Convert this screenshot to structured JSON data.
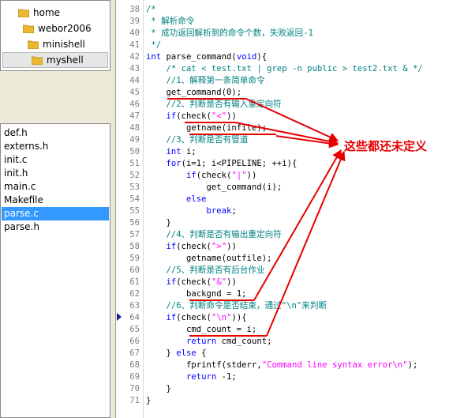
{
  "folder_tree": {
    "items": [
      {
        "label": "home"
      },
      {
        "label": "webor2006"
      },
      {
        "label": "minishell"
      },
      {
        "label": "myshell",
        "selected": true
      }
    ]
  },
  "file_list": {
    "items": [
      {
        "label": "def.h"
      },
      {
        "label": "externs.h"
      },
      {
        "label": "init.c"
      },
      {
        "label": "init.h"
      },
      {
        "label": "main.c"
      },
      {
        "label": "Makefile"
      },
      {
        "label": "parse.c",
        "selected": true
      },
      {
        "label": "parse.h"
      }
    ]
  },
  "editor": {
    "lines": [
      {
        "n": "38",
        "segs": [
          {
            "c": "comment",
            "t": "/*"
          }
        ]
      },
      {
        "n": "39",
        "segs": [
          {
            "c": "comment",
            "t": " * 解析命令"
          }
        ]
      },
      {
        "n": "40",
        "segs": [
          {
            "c": "comment",
            "t": " * 成功返回解析到的命令个数，失败返回-1"
          }
        ]
      },
      {
        "n": "41",
        "segs": [
          {
            "c": "comment",
            "t": " */"
          }
        ]
      },
      {
        "n": "42",
        "segs": [
          {
            "c": "keyword",
            "t": "int"
          },
          {
            "c": "plain",
            "t": " parse_command("
          },
          {
            "c": "keyword",
            "t": "void"
          },
          {
            "c": "plain",
            "t": "){"
          }
        ]
      },
      {
        "n": "43",
        "segs": [
          {
            "c": "comment",
            "t": "    /* cat < test.txt | grep -n public > test2.txt & */"
          }
        ]
      },
      {
        "n": "44",
        "segs": [
          {
            "c": "comment",
            "t": "    //1、解释第一条简单命令"
          }
        ]
      },
      {
        "n": "45",
        "segs": [
          {
            "c": "plain",
            "t": "    get_command(0);"
          }
        ]
      },
      {
        "n": "46",
        "segs": [
          {
            "c": "comment",
            "t": "    //2、判断是否有输入重定向符"
          }
        ]
      },
      {
        "n": "47",
        "segs": [
          {
            "c": "keyword",
            "t": "    if"
          },
          {
            "c": "plain",
            "t": "(check("
          },
          {
            "c": "string",
            "t": "\"<\""
          },
          {
            "c": "plain",
            "t": "))"
          }
        ]
      },
      {
        "n": "48",
        "segs": [
          {
            "c": "plain",
            "t": "        getname(infile);"
          }
        ]
      },
      {
        "n": "49",
        "segs": [
          {
            "c": "comment",
            "t": "    //3、判断是否有管道"
          }
        ]
      },
      {
        "n": "50",
        "segs": [
          {
            "c": "keyword",
            "t": "    int"
          },
          {
            "c": "plain",
            "t": " i;"
          }
        ]
      },
      {
        "n": "51",
        "segs": [
          {
            "c": "keyword",
            "t": "    for"
          },
          {
            "c": "plain",
            "t": "(i=1; i<PIPELINE; ++i){"
          }
        ]
      },
      {
        "n": "52",
        "segs": [
          {
            "c": "keyword",
            "t": "        if"
          },
          {
            "c": "plain",
            "t": "(check("
          },
          {
            "c": "string",
            "t": "\"|\""
          },
          {
            "c": "plain",
            "t": "))"
          }
        ]
      },
      {
        "n": "53",
        "segs": [
          {
            "c": "plain",
            "t": "            get_command(i);"
          }
        ]
      },
      {
        "n": "54",
        "segs": [
          {
            "c": "keyword",
            "t": "        else"
          }
        ]
      },
      {
        "n": "55",
        "segs": [
          {
            "c": "keyword",
            "t": "            break"
          },
          {
            "c": "plain",
            "t": ";"
          }
        ]
      },
      {
        "n": "56",
        "segs": [
          {
            "c": "plain",
            "t": "    }"
          }
        ]
      },
      {
        "n": "57",
        "segs": [
          {
            "c": "comment",
            "t": "    //4、判断是否有输出重定向符"
          }
        ]
      },
      {
        "n": "58",
        "segs": [
          {
            "c": "keyword",
            "t": "    if"
          },
          {
            "c": "plain",
            "t": "(check("
          },
          {
            "c": "string",
            "t": "\">\""
          },
          {
            "c": "plain",
            "t": "))"
          }
        ]
      },
      {
        "n": "59",
        "segs": [
          {
            "c": "plain",
            "t": "        getname(outfile);"
          }
        ]
      },
      {
        "n": "60",
        "segs": [
          {
            "c": "comment",
            "t": "    //5、判断是否有后台作业"
          }
        ]
      },
      {
        "n": "61",
        "segs": [
          {
            "c": "keyword",
            "t": "    if"
          },
          {
            "c": "plain",
            "t": "(check("
          },
          {
            "c": "string",
            "t": "\"&\""
          },
          {
            "c": "plain",
            "t": "))"
          }
        ]
      },
      {
        "n": "62",
        "segs": [
          {
            "c": "plain",
            "t": "        backgnd = 1;"
          }
        ]
      },
      {
        "n": "63",
        "segs": [
          {
            "c": "comment",
            "t": "    //6、判断命令是否结束，通过\"\\n\"来判断"
          }
        ]
      },
      {
        "n": "64",
        "segs": [
          {
            "c": "keyword",
            "t": "    if"
          },
          {
            "c": "plain",
            "t": "(check("
          },
          {
            "c": "string",
            "t": "\"\\n\""
          },
          {
            "c": "plain",
            "t": ")){"
          }
        ]
      },
      {
        "n": "65",
        "segs": [
          {
            "c": "plain",
            "t": "        cmd_count = i;"
          }
        ]
      },
      {
        "n": "66",
        "segs": [
          {
            "c": "keyword",
            "t": "        return"
          },
          {
            "c": "plain",
            "t": " cmd_count;"
          }
        ]
      },
      {
        "n": "67",
        "segs": [
          {
            "c": "plain",
            "t": "    } "
          },
          {
            "c": "keyword",
            "t": "else"
          },
          {
            "c": "plain",
            "t": " {"
          }
        ]
      },
      {
        "n": "68",
        "segs": [
          {
            "c": "plain",
            "t": "        fprintf(stderr,"
          },
          {
            "c": "string",
            "t": "\"Command line syntax error\\n\""
          },
          {
            "c": "plain",
            "t": ");"
          }
        ]
      },
      {
        "n": "69",
        "segs": [
          {
            "c": "keyword",
            "t": "        return"
          },
          {
            "c": "plain",
            "t": " -1;"
          }
        ]
      },
      {
        "n": "70",
        "segs": [
          {
            "c": "plain",
            "t": "    }"
          }
        ]
      },
      {
        "n": "71",
        "segs": [
          {
            "c": "plain",
            "t": "}"
          }
        ]
      }
    ]
  },
  "annotation": {
    "text": "这些都还未定义",
    "color": "#e60000"
  },
  "colors": {
    "comment": "#008080",
    "keyword": "#0000ff",
    "string": "#ff00ff",
    "selection": "#3399ff"
  }
}
